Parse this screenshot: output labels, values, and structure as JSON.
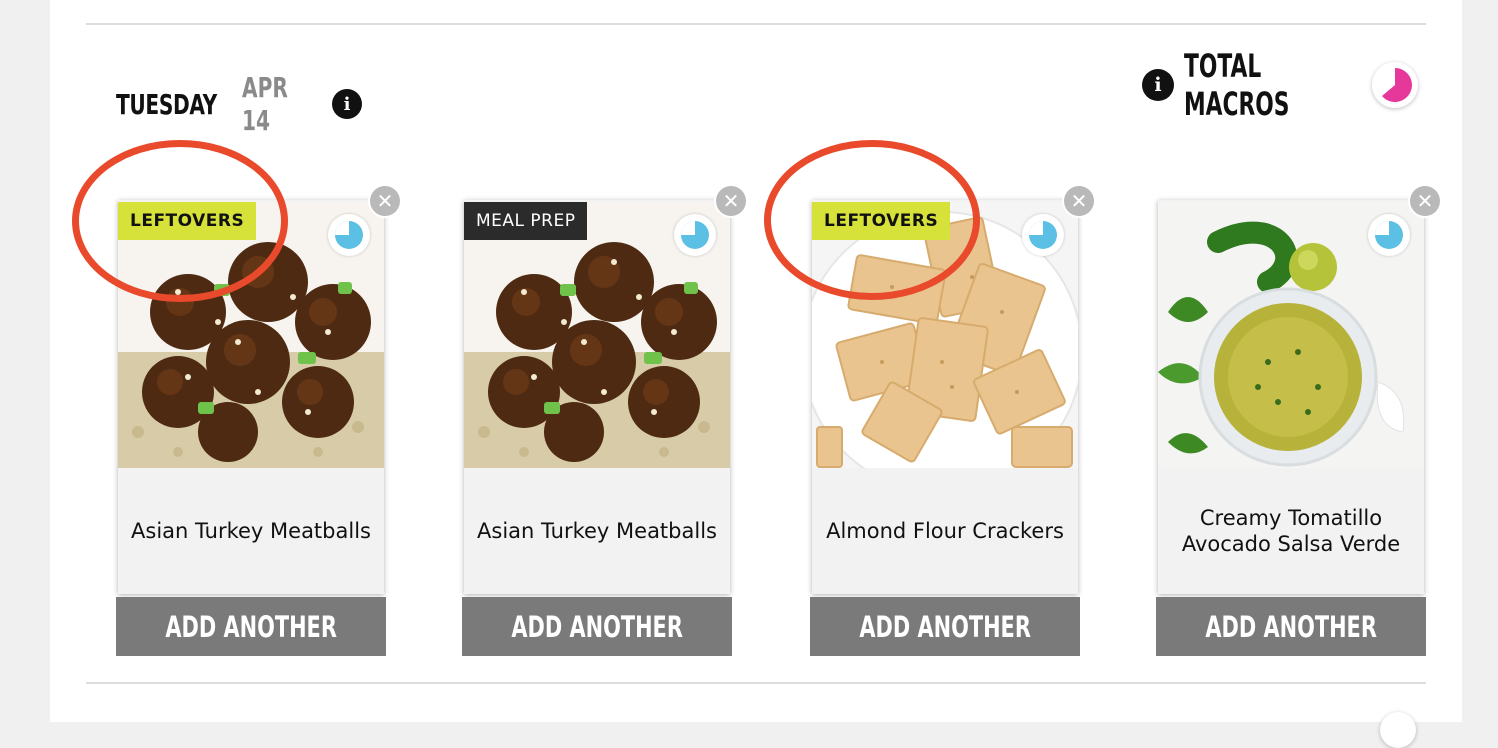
{
  "day": {
    "name": "TUESDAY",
    "date": "APR 14",
    "info_icon": "info-icon"
  },
  "macros": {
    "label": "TOTAL MACROS",
    "info_icon": "info-icon",
    "pie_color": "#e6389b"
  },
  "cards": [
    {
      "tag": "LEFTOVERS",
      "tag_type": "leftovers",
      "name": "Asian Turkey Meatballs",
      "add_label": "ADD ANOTHER",
      "image": "meatballs"
    },
    {
      "tag": "MEAL PREP",
      "tag_type": "mealprep",
      "name": "Asian Turkey Meatballs",
      "add_label": "ADD ANOTHER",
      "image": "meatballs"
    },
    {
      "tag": "LEFTOVERS",
      "tag_type": "leftovers",
      "name": "Almond Flour Crackers",
      "add_label": "ADD ANOTHER",
      "image": "crackers"
    },
    {
      "tag": "",
      "tag_type": "none",
      "name": "Creamy Tomatillo Avocado Salsa Verde",
      "add_label": "ADD ANOTHER",
      "image": "salsa"
    }
  ],
  "colors": {
    "accent_leftovers": "#d6e13a",
    "accent_mealprep": "#2b2b2b",
    "button_bg": "#7a7a7a",
    "timer_color": "#5bc0e3",
    "annotation": "#e94a2c"
  }
}
